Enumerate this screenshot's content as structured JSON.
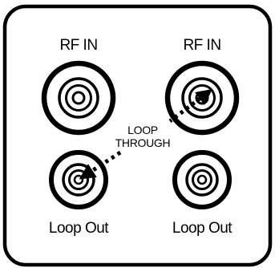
{
  "panel": {
    "ports": [
      {
        "id": "rf-in-left",
        "label": "RF IN"
      },
      {
        "id": "rf-in-right",
        "label": "RF IN"
      },
      {
        "id": "loop-out-left",
        "label": "Loop Out"
      },
      {
        "id": "loop-out-right",
        "label": "Loop Out"
      }
    ],
    "loop_label_line1": "LOOP",
    "loop_label_line2": "THROUGH"
  },
  "colors": {
    "ink": "#000000",
    "background": "#ffffff"
  }
}
